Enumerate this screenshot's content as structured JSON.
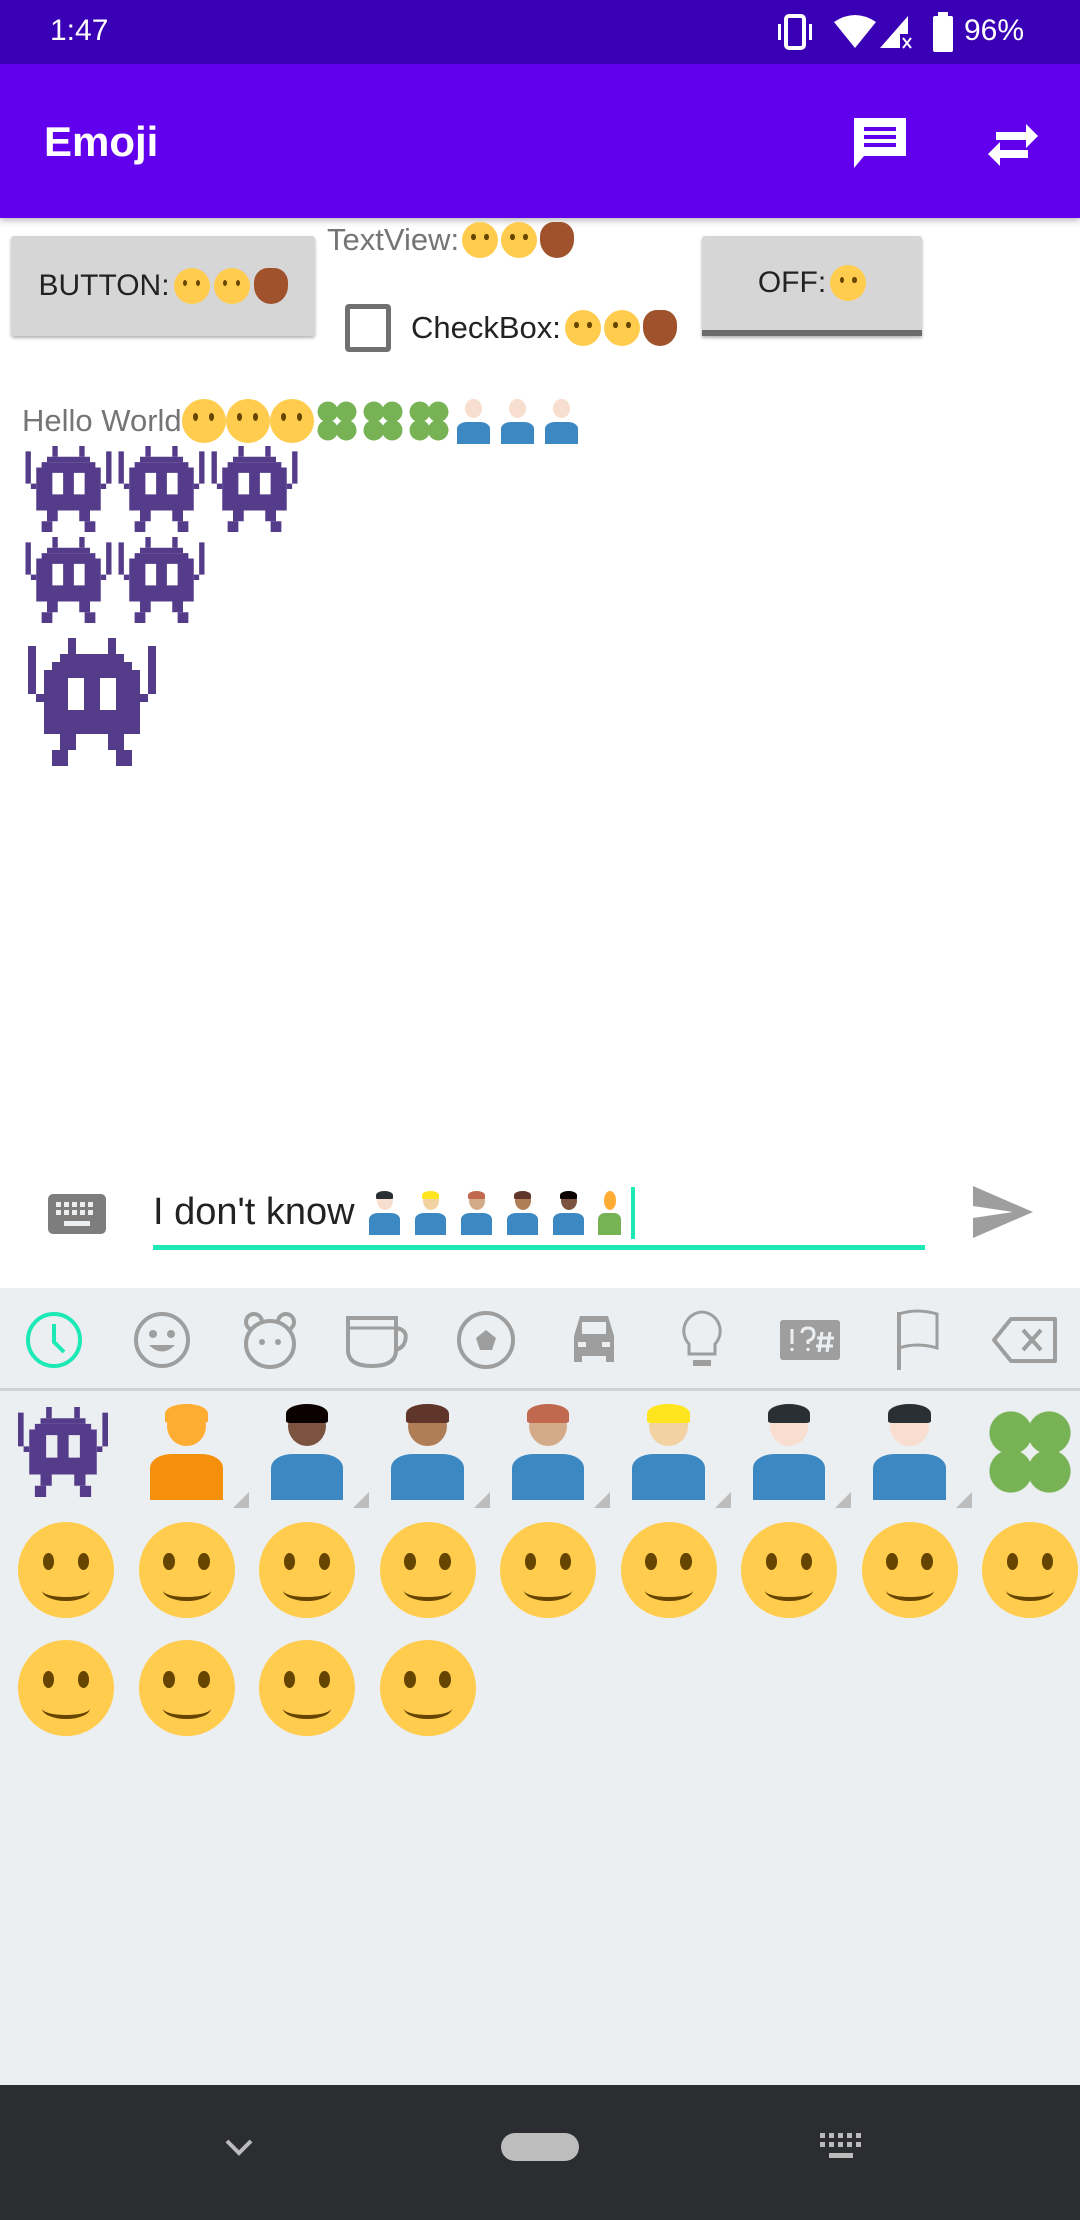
{
  "status_bar": {
    "time": "1:47",
    "battery": "96%",
    "icons": [
      "vibrate-icon",
      "wifi-icon",
      "cell-signal-off-icon",
      "battery-icon"
    ]
  },
  "app_bar": {
    "title": "Emoji",
    "actions": [
      "message-icon",
      "swap-icon"
    ]
  },
  "widgets": {
    "button_label": "BUTTON:",
    "button_emojis": [
      "face-blowing-kiss",
      "face-with-tears-of-joy",
      "deer"
    ],
    "textview_label": "TextView:",
    "textview_emojis": [
      "face-blowing-kiss",
      "face-with-tears-of-joy",
      "deer"
    ],
    "checkbox_label": "CheckBox:",
    "checkbox_emojis": [
      "face-blowing-kiss",
      "face-with-tears-of-joy",
      "deer"
    ],
    "checkbox_checked": false,
    "toggle_label": "OFF:",
    "toggle_emojis": [
      "face-with-tears-of-joy"
    ]
  },
  "hello": {
    "text": "Hello World",
    "emojis": [
      "hugging-face",
      "smiling-face-with-sunglasses",
      "nerd-face",
      "four-leaf-clover",
      "four-leaf-clover",
      "four-leaf-clover",
      "person-lifting-weights",
      "person-lifting-weights",
      "person-lifting-weights"
    ]
  },
  "invaders": {
    "rows": [
      3,
      2,
      1
    ],
    "color": "#553c8b"
  },
  "input": {
    "text": "I don't know",
    "emojis": [
      "man-shrugging-light",
      "man-facepalming-medium-light",
      "man-gesturing-no-medium",
      "man-medium-dark",
      "man-dark",
      "person-kneeling"
    ],
    "accent": "#1de9b6"
  },
  "emoji_keyboard": {
    "tabs": [
      "recent-icon",
      "smiley-icon",
      "animal-icon",
      "food-icon",
      "activity-icon",
      "travel-icon",
      "objects-icon",
      "symbols-icon",
      "flags-icon",
      "backspace-icon"
    ],
    "active_tab": "recent-icon",
    "recent": [
      "alien-monster",
      "person-kneeling",
      "man-dark",
      "man-medium-dark",
      "man-gesturing-no",
      "man-facepalming",
      "man-shrugging",
      "person-lifting-weights",
      "four-leaf-clover",
      "nerd-face",
      "smiling-face-with-sunglasses",
      "hugging-face",
      "grinning-squinting-face",
      "rolling-on-the-floor-laughing",
      "squinting-face-with-tongue",
      "face-with-tears-of-joy",
      "drooling-face",
      "kissing-face-with-smiling-eyes",
      "smirking-face",
      "thinking-face",
      "partying-face",
      "face-with-tongue"
    ]
  },
  "nav_bar": {
    "icons": [
      "chevron-down-icon",
      "home-pill-icon",
      "keyboard-icon"
    ]
  }
}
